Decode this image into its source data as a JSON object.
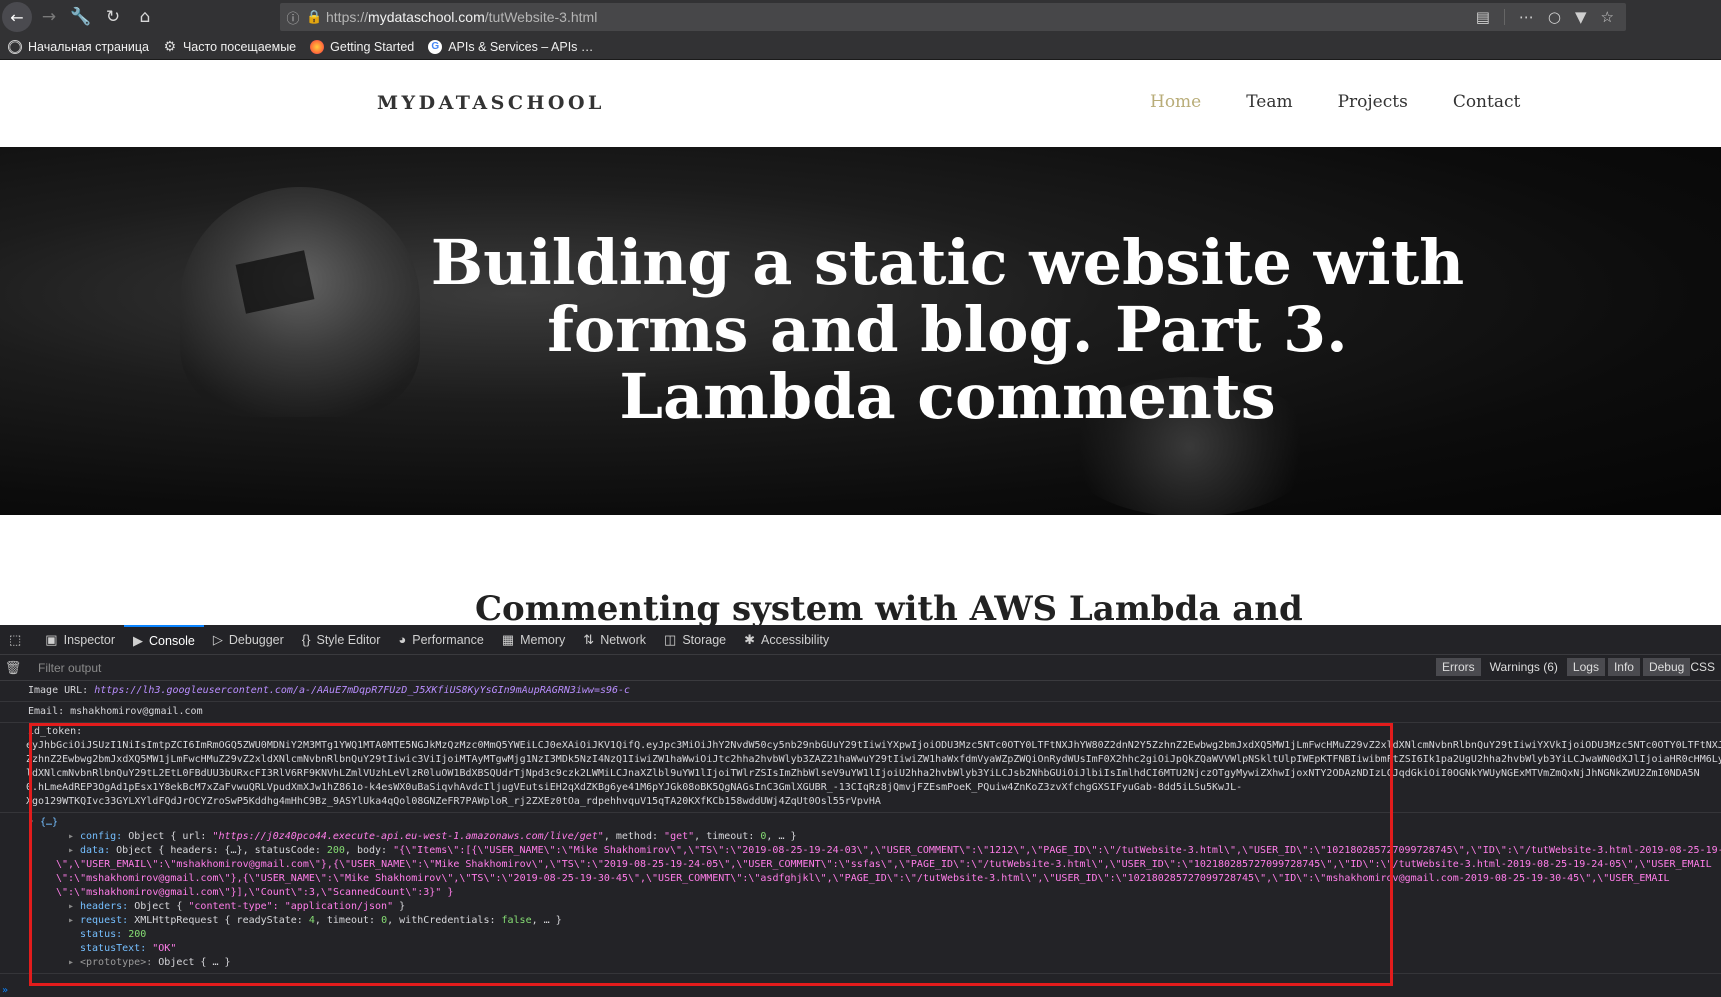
{
  "browser": {
    "url_prefix": "https://",
    "url_host": "mydataschool.com",
    "url_path": "/tutWebsite-3.html",
    "bookmarks": [
      "Начальная страница",
      "Часто посещаемые",
      "Getting Started",
      "APIs & Services – APIs …"
    ]
  },
  "site": {
    "logo": "MYDATASCHOOL",
    "menu": [
      "Home",
      "Team",
      "Projects",
      "Contact"
    ],
    "hero_title": "Building a static website with forms and blog. Part 3. Lambda comments",
    "subheading": "Commenting system with AWS Lambda and"
  },
  "devtools": {
    "tabs": [
      "Inspector",
      "Console",
      "Debugger",
      "Style Editor",
      "Performance",
      "Memory",
      "Network",
      "Storage",
      "Accessibility"
    ],
    "filter_placeholder": "Filter output",
    "levels": [
      "Errors",
      "Warnings (6)",
      "Logs",
      "Info",
      "Debug"
    ],
    "css_label": "CSS",
    "log": {
      "image_url_label": "Image URL:",
      "image_url": "https://lh3.googleusercontent.com/a-/AAuE7mDqpR7FUzD_J5XKfiUS8KyYsGIn9mAupRAGRN3iww=s96-c",
      "email_line": "Email: mshakhomirov@gmail.com",
      "id_token_label": "id_token:",
      "id_token_lines": [
        "eyJhbGciOiJSUzI1NiIsImtpZCI6ImRmOGQ5ZWU0MDNiY2M3MTg1YWQ1MTA0MTE5NGJkMzQzMzc0MmQ5YWEiLCJ0eXAiOiJKV1QifQ.eyJpc3MiOiJhY2NvdW50cy5nb29nbGUuY29tIiwiYXpwIjoiODU3Mzc5NTc0OTY0LTFtNXJhYW80Z2dnN2Y5ZzhnZ2Ewbwg2bmJxdXQ5MW1jLmFwcHMuZ29vZ2xldXNlcmNvbnRlbnQuY29tIiwiYXVkIjoiODU3Mzc5NTc0OTY0LTFtNXJ",
        "ZzhnZ2Ewbwg2bmJxdXQ5MW1jLmFwcHMuZ29vZ2xldXNlcmNvbnRlbnQuY29tIiwic3ViIjoiMTAyMTgwMjg1NzI3MDk5NzI4NzQ1IiwiZW1haWwiOiJtc2hha2hvbWlyb3ZAZ21haWwuY29tIiwiZW1haWxfdmVyaWZpZWQiOnRydWUsImF0X2hhc2giOiJpQkZQaWVVWlpNSkltUlpIWEpKTFNBIiwibmFtZSI6Ik1pa2UgU2hha2hvbWlyb3YiLCJwaWN0dXJlIjoiaHR0cHM6Ly",
        "ldXNlcmNvbnRlbnQuY29tL2EtL0FBdUU3bURxcFI3RlV6RF9KNVhLZmlVUzhLeVlzR0luOW1BdXBSQUdrTjNpd3c9czk2LWMiLCJnaXZlbl9uYW1lIjoiTWlrZSIsImZhbWlseV9uYW1lIjoiU2hha2hvbWlyb3YiLCJsb2NhbGUiOiJlbiIsImlhdCI6MTU2NjczOTgyMywiZXhwIjoxNTY2ODAzNDIzLCJqdGkiOiI0OGNkYWUyNGExMTVmZmQxNjJhNGNkZWU2ZmI0NDA5N",
        "0.hLmeAdREP3OgAd1pEsx1Y8ekBcM7xZaFvwuQRLVpudXmXJw1hZ861o-k4esWX0uBaSiqvhAvdcIljugVEutsiEH2qXdZKBg6ye41M6pYJGk08oBK5QgNAGsInC3GmlXGUBR_-13CIqRz8jQmvjFZEsmPoeK_PQuiw4ZnKoZ3zvXfchgGXSIFyuGab-8dd5iLSu5KwJL-",
        "Xgo129WTKQIvc33GYLXYldFQdJrOCYZroSwP5Kddhg4mHhC9Bz_9ASYlUka4qQol08GNZeFR7PAWploR_rj2ZXEz0tOa_rdpehhvquV15qTA20KXfKCb158wddUWj4ZqUt0Osl55rVpvHA"
      ],
      "object_header": "{…}",
      "config_key": "config:",
      "config_text": "Object { url: ",
      "config_url": "\"https://j0z40pco44.execute-api.eu-west-1.amazonaws.com/live/get\"",
      "config_tail_a": ", method: ",
      "config_method": "\"get\"",
      "config_tail_b": ", timeout: ",
      "config_timeout": "0",
      "config_tail_c": ", … }",
      "data_key": "data:",
      "data_text": "Object { headers: {…}, statusCode: ",
      "data_status_code": "200",
      "data_body_label": ", body: ",
      "data_body_lines": [
        "\"{\\\"Items\\\":[{\\\"USER_NAME\\\":\\\"Mike Shakhomirov\\\",\\\"TS\\\":\\\"2019-08-25-19-24-03\\\",\\\"USER_COMMENT\\\":\\\"1212\\\",\\\"PAGE_ID\\\":\\\"/tutWebsite-3.html\\\",\\\"USER_ID\\\":\\\"102180285727099728745\\\",\\\"ID\\\":\\\"/tutWebsite-3.html-2019-08-25-19-24-03",
        "\\\",\\\"USER_EMAIL\\\":\\\"mshakhomirov@gmail.com\\\"},{\\\"USER_NAME\\\":\\\"Mike Shakhomirov\\\",\\\"TS\\\":\\\"2019-08-25-19-24-05\\\",\\\"USER_COMMENT\\\":\\\"ssfas\\\",\\\"PAGE_ID\\\":\\\"/tutWebsite-3.html\\\",\\\"USER_ID\\\":\\\"102180285727099728745\\\",\\\"ID\\\":\\\"/tutWebsite-3.html-2019-08-25-19-24-05\\\",\\\"USER_EMAIL",
        "\\\":\\\"mshakhomirov@gmail.com\\\"},{\\\"USER_NAME\\\":\\\"Mike Shakhomirov\\\",\\\"TS\\\":\\\"2019-08-25-19-30-45\\\",\\\"USER_COMMENT\\\":\\\"asdfghjkl\\\",\\\"PAGE_ID\\\":\\\"/tutWebsite-3.html\\\",\\\"USER_ID\\\":\\\"102180285727099728745\\\",\\\"ID\\\":\\\"mshakhomirov@gmail.com-2019-08-25-19-30-45\\\",\\\"USER_EMAIL",
        "\\\":\\\"mshakhomirov@gmail.com\\\"}],\\\"Count\\\":3,\\\"ScannedCount\\\":3}\" }"
      ],
      "headers_key": "headers:",
      "headers_text": "Object { ",
      "headers_value": "\"content-type\": \"application/json\"",
      "headers_tail": " }",
      "request_key": "request:",
      "request_text": "XMLHttpRequest { readyState: ",
      "request_ready": "4",
      "request_mid": ", timeout: ",
      "request_timeout": "0",
      "request_mid2": ", withCredentials: ",
      "request_cred": "false",
      "request_tail": ", … }",
      "status_key": "status:",
      "status_value": "200",
      "status_text_key": "statusText:",
      "status_text_value": "\"OK\"",
      "prototype_key": "<prototype>:",
      "prototype_value": "Object { … }"
    },
    "prompt_symbol": "»"
  }
}
